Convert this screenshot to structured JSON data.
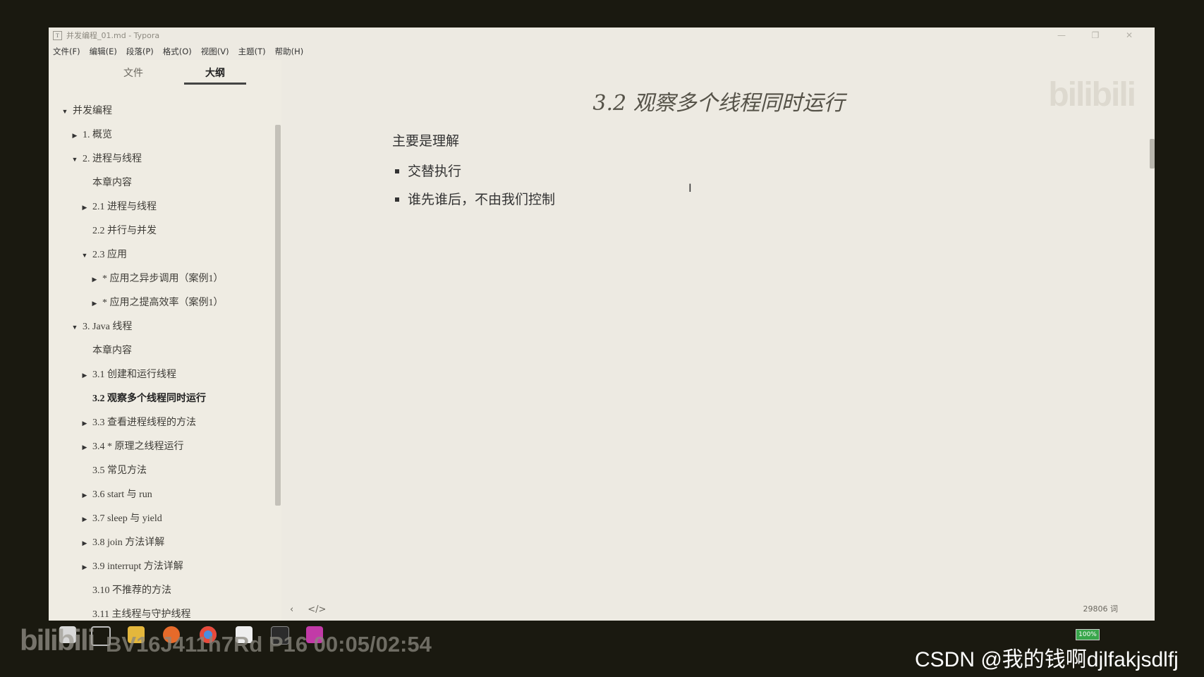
{
  "window": {
    "icon": "T",
    "title": "并发编程_01.md - Typora",
    "controls": [
      "—",
      "❐",
      "✕"
    ]
  },
  "menu": [
    "文件(F)",
    "编辑(E)",
    "段落(P)",
    "格式(O)",
    "视图(V)",
    "主题(T)",
    "帮助(H)"
  ],
  "sidebar": {
    "tabs": {
      "files": "文件",
      "outline": "大纲"
    },
    "outline": [
      {
        "label": "并发编程",
        "level": 0,
        "caret": "open"
      },
      {
        "label": "1. 概览",
        "level": 1,
        "caret": "closed"
      },
      {
        "label": "2. 进程与线程",
        "level": 1,
        "caret": "open"
      },
      {
        "label": "本章内容",
        "level": 2,
        "caret": "none"
      },
      {
        "label": "2.1 进程与线程",
        "level": 2,
        "caret": "closed"
      },
      {
        "label": "2.2 并行与并发",
        "level": 2,
        "caret": "none"
      },
      {
        "label": "2.3 应用",
        "level": 2,
        "caret": "open"
      },
      {
        "label": "* 应用之异步调用（案例1）",
        "level": 3,
        "caret": "closed"
      },
      {
        "label": "* 应用之提高效率（案例1）",
        "level": 3,
        "caret": "closed"
      },
      {
        "label": "3. Java 线程",
        "level": 1,
        "caret": "open"
      },
      {
        "label": "本章内容",
        "level": 2,
        "caret": "none"
      },
      {
        "label": "3.1 创建和运行线程",
        "level": 2,
        "caret": "closed"
      },
      {
        "label": "3.2 观察多个线程同时运行",
        "level": 2,
        "caret": "none",
        "active": true
      },
      {
        "label": "3.3 查看进程线程的方法",
        "level": 2,
        "caret": "closed"
      },
      {
        "label": "3.4 * 原理之线程运行",
        "level": 2,
        "caret": "closed"
      },
      {
        "label": "3.5 常见方法",
        "level": 2,
        "caret": "none"
      },
      {
        "label": "3.6 start 与 run",
        "level": 2,
        "caret": "closed"
      },
      {
        "label": "3.7 sleep 与 yield",
        "level": 2,
        "caret": "closed"
      },
      {
        "label": "3.8 join 方法详解",
        "level": 2,
        "caret": "closed"
      },
      {
        "label": "3.9 interrupt 方法详解",
        "level": 2,
        "caret": "closed"
      },
      {
        "label": "3.10 不推荐的方法",
        "level": 2,
        "caret": "none"
      },
      {
        "label": "3.11 主线程与守护线程",
        "level": 2,
        "caret": "none"
      }
    ]
  },
  "editor": {
    "heading": "3.2 观察多个线程同时运行",
    "paragraph": "主要是理解",
    "bullets": [
      "交替执行",
      "谁先谁后，不由我们控制"
    ],
    "status_left": [
      "‹",
      "</>"
    ],
    "word_count": "29806 词"
  },
  "overlay": {
    "bili_logo": "bilibili",
    "video_info": "BV16J411h7Rd P16 00:05/02:54",
    "battery": "100%",
    "watermark": "CSDN @我的钱啊djlfakjsdlfj"
  },
  "colors": {
    "paper": "#edeae2",
    "sidebar": "#efece3",
    "frame": "#1a1910"
  }
}
